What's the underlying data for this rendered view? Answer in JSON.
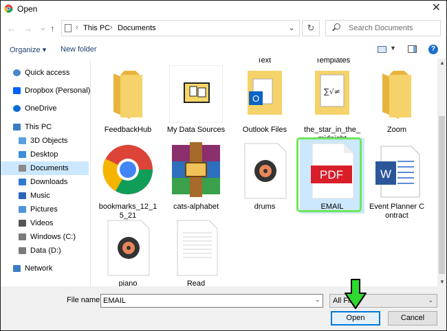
{
  "window": {
    "title": "Open",
    "close_glyph": "✕"
  },
  "nav": {
    "back_glyph": "←",
    "forward_glyph": "→",
    "recent_glyph": "⌄",
    "up_glyph": "↑",
    "breadcrumbs": [
      "This PC",
      "Documents"
    ],
    "separator": "›",
    "refresh_glyph": "↻",
    "search_placeholder": "Search Documents"
  },
  "toolbar": {
    "organize": "Organize ▾",
    "new_folder": "New folder",
    "help": "?"
  },
  "sidebar": {
    "items": [
      {
        "label": "Quick access",
        "icon": "star-icon"
      },
      {
        "label": "Dropbox (Personal)",
        "icon": "dropbox-icon"
      },
      {
        "label": "OneDrive",
        "icon": "cloud-icon"
      },
      {
        "label": "This PC",
        "icon": "computer-icon"
      },
      {
        "label": "3D Objects",
        "icon": "cube-icon"
      },
      {
        "label": "Desktop",
        "icon": "desktop-icon"
      },
      {
        "label": "Documents",
        "icon": "documents-icon",
        "selected": true
      },
      {
        "label": "Downloads",
        "icon": "download-icon"
      },
      {
        "label": "Music",
        "icon": "music-icon"
      },
      {
        "label": "Pictures",
        "icon": "pictures-icon"
      },
      {
        "label": "Videos",
        "icon": "videos-icon"
      },
      {
        "label": "Windows (C:)",
        "icon": "drive-icon"
      },
      {
        "label": "Data (D:)",
        "icon": "drive-icon"
      },
      {
        "label": "Network",
        "icon": "network-icon"
      }
    ]
  },
  "partial_labels": [
    "Text",
    "Templates"
  ],
  "files": [
    {
      "name": "FeedbackHub",
      "icon": "folder-icon"
    },
    {
      "name": "My Data Sources",
      "icon": "data-sources-icon"
    },
    {
      "name": "Outlook Files",
      "icon": "outlook-folder-icon"
    },
    {
      "name": "the_star_in_the_midnight",
      "icon": "math-folder-icon"
    },
    {
      "name": "Zoom",
      "icon": "folder-icon"
    },
    {
      "name": "bookmarks_12_15_21",
      "icon": "chrome-icon"
    },
    {
      "name": "cats-alphabet",
      "icon": "winrar-icon"
    },
    {
      "name": "drums",
      "icon": "audio-file-icon"
    },
    {
      "name": "EMAIL",
      "icon": "pdf-icon",
      "selected": true
    },
    {
      "name": "Event Planner Contract",
      "icon": "word-icon"
    },
    {
      "name": "piano",
      "icon": "audio-file-icon"
    },
    {
      "name": "Read",
      "icon": "text-file-icon"
    }
  ],
  "pdf_badge": "PDF",
  "math_glyph": "∑√≠",
  "footer": {
    "file_name_label": "File name:",
    "file_name_value": "EMAIL",
    "file_type": "All Fil",
    "open": "Open",
    "cancel": "Cancel"
  },
  "colors": {
    "accent": "#0078d7",
    "selection": "#cce8ff",
    "annotation": "#6ee65c"
  }
}
